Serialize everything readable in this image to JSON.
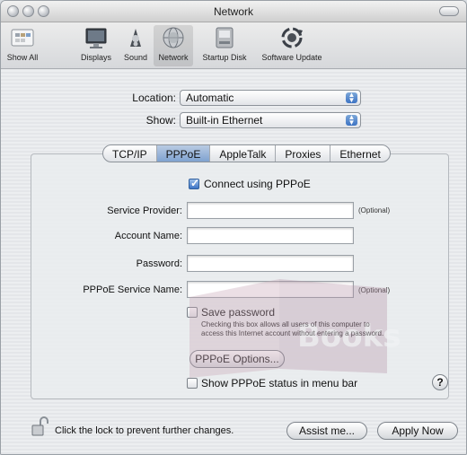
{
  "window": {
    "title": "Network"
  },
  "toolbar": {
    "items": [
      {
        "label": "Show All",
        "icon": "show-all-icon"
      },
      {
        "label": "Displays",
        "icon": "display-icon"
      },
      {
        "label": "Sound",
        "icon": "speaker-icon"
      },
      {
        "label": "Network",
        "icon": "network-globe-icon",
        "selected": true
      },
      {
        "label": "Startup Disk",
        "icon": "disk-icon"
      },
      {
        "label": "Software Update",
        "icon": "update-icon"
      }
    ]
  },
  "location": {
    "label": "Location:",
    "value": "Automatic"
  },
  "show": {
    "label": "Show:",
    "value": "Built-in Ethernet"
  },
  "tabs": [
    {
      "label": "TCP/IP"
    },
    {
      "label": "PPPoE",
      "active": true
    },
    {
      "label": "AppleTalk"
    },
    {
      "label": "Proxies"
    },
    {
      "label": "Ethernet"
    }
  ],
  "pppoe": {
    "connect_label": "Connect using PPPoE",
    "connect_checked": true,
    "service_provider_label": "Service Provider:",
    "service_provider_value": "",
    "account_name_label": "Account Name:",
    "account_name_value": "",
    "password_label": "Password:",
    "password_value": "",
    "service_name_label": "PPPoE Service Name:",
    "service_name_value": "",
    "optional_label": "(Optional)",
    "save_password_label": "Save password",
    "save_password_checked": false,
    "save_password_note_1": "Checking this box allows all users of this computer to",
    "save_password_note_2": "access this Internet account without entering a password.",
    "options_button": "PPPoE Options...",
    "show_status_label": "Show PPPoE status in menu bar",
    "show_status_checked": false,
    "help": "?"
  },
  "footer": {
    "lock_text": "Click the lock to prevent further changes.",
    "assist_button": "Assist me...",
    "apply_button": "Apply Now"
  },
  "watermark": {
    "text": "Books"
  },
  "colors": {
    "accent": "#3d74c6",
    "tab_active": "#9db8dc"
  }
}
